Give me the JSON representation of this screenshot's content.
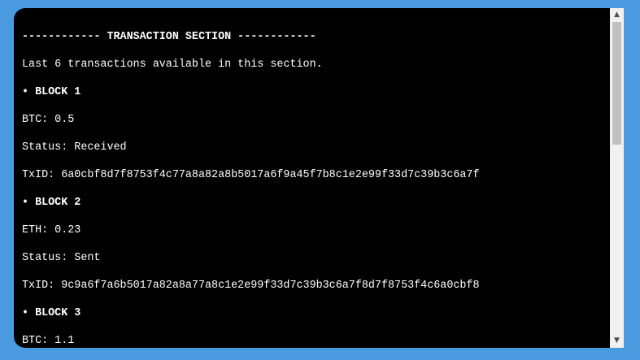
{
  "terminal": {
    "header": "------------ TRANSACTION SECTION ------------",
    "intro": "Last 6 transactions available in this section.",
    "blocks": [
      {
        "title": "• BLOCK 1",
        "amount": "BTC: 0.5",
        "status": "Status: Received",
        "txid": "TxID: 6a0cbf8d7f8753f4c77a8a82a8b5017a6f9a45f7b8c1e2e99f33d7c39b3c6a7f"
      },
      {
        "title": "• BLOCK 2",
        "amount": "ETH: 0.23",
        "status": "Status: Sent",
        "txid": "TxID: 9c9a6f7a6b5017a82a8a77a8c1e2e99f33d7c39b3c6a7f8d7f8753f4c6a0cbf8"
      },
      {
        "title": "• BLOCK 3",
        "amount": "BTC: 1.1"
      }
    ]
  },
  "scrollbar": {
    "up_icon": "▲",
    "down_icon": "▼"
  },
  "colors": {
    "background": "#4a9ae0",
    "terminal_bg": "#000000",
    "text": "#ffffff"
  }
}
